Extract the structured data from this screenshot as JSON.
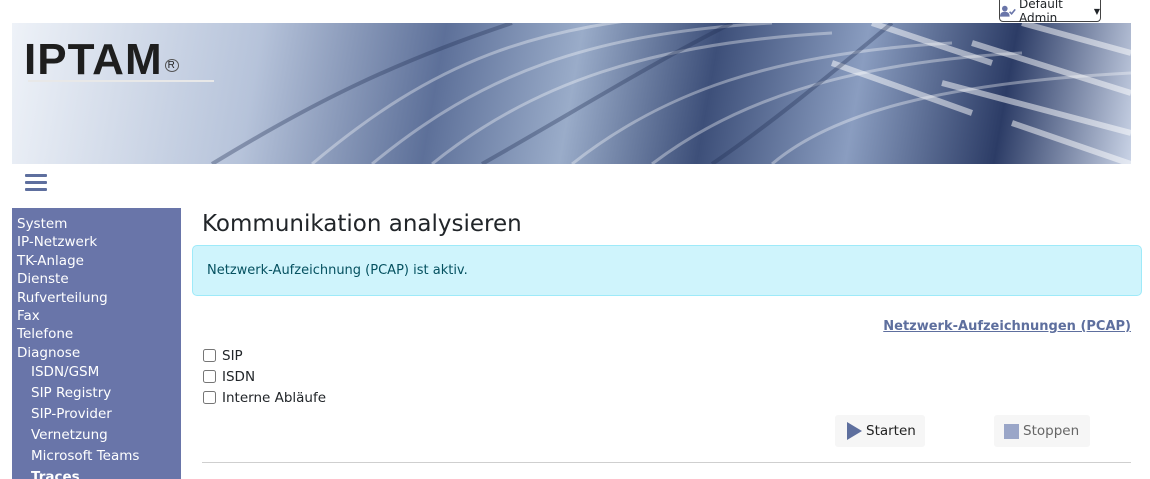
{
  "header": {
    "user_label": "Default Admin",
    "logo": "IPTAM",
    "logo_reg": "R"
  },
  "sidebar": {
    "items": [
      "System",
      "IP-Netzwerk",
      "TK-Anlage",
      "Dienste",
      "Rufverteilung",
      "Fax",
      "Telefone",
      "Diagnose"
    ],
    "subitems": [
      "ISDN/GSM",
      "SIP Registry",
      "SIP-Provider",
      "Vernetzung",
      "Microsoft Teams",
      "Traces"
    ],
    "active_subitem": "Traces"
  },
  "main": {
    "title": "Kommunikation analysieren",
    "alert": "Netzwerk-Aufzeichnung (PCAP) ist aktiv.",
    "pcap_link": "Netzwerk-Aufzeichnungen (PCAP)",
    "checkboxes": [
      {
        "label": "SIP",
        "checked": false
      },
      {
        "label": "ISDN",
        "checked": false
      },
      {
        "label": "Interne Abläufe",
        "checked": false
      }
    ],
    "start_label": "Starten",
    "stop_label": "Stoppen"
  },
  "colors": {
    "sidebar_bg": "#6975a9",
    "accent": "#5e6f9e",
    "alert_bg": "#cff4fc",
    "alert_text": "#055160"
  },
  "icons": [
    "user-check-icon",
    "caret-down-icon",
    "hamburger-icon",
    "play-icon",
    "stop-icon"
  ]
}
